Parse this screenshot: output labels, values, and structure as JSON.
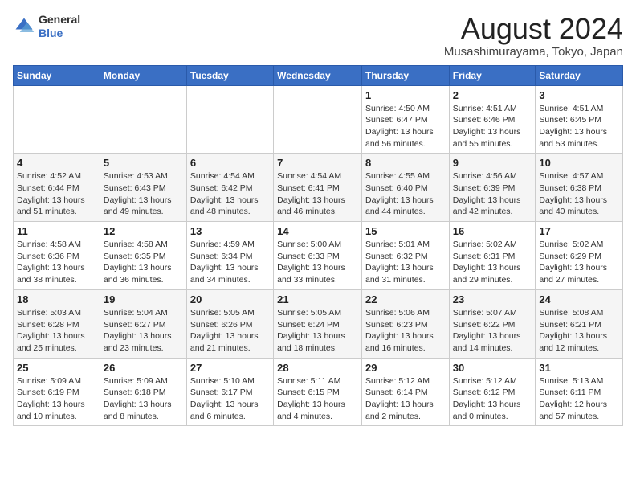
{
  "header": {
    "logo_general": "General",
    "logo_blue": "Blue",
    "main_title": "August 2024",
    "subtitle": "Musashimurayama, Tokyo, Japan"
  },
  "weekdays": [
    "Sunday",
    "Monday",
    "Tuesday",
    "Wednesday",
    "Thursday",
    "Friday",
    "Saturday"
  ],
  "weeks": [
    [
      {
        "day": "",
        "info": ""
      },
      {
        "day": "",
        "info": ""
      },
      {
        "day": "",
        "info": ""
      },
      {
        "day": "",
        "info": ""
      },
      {
        "day": "1",
        "info": "Sunrise: 4:50 AM\nSunset: 6:47 PM\nDaylight: 13 hours\nand 56 minutes."
      },
      {
        "day": "2",
        "info": "Sunrise: 4:51 AM\nSunset: 6:46 PM\nDaylight: 13 hours\nand 55 minutes."
      },
      {
        "day": "3",
        "info": "Sunrise: 4:51 AM\nSunset: 6:45 PM\nDaylight: 13 hours\nand 53 minutes."
      }
    ],
    [
      {
        "day": "4",
        "info": "Sunrise: 4:52 AM\nSunset: 6:44 PM\nDaylight: 13 hours\nand 51 minutes."
      },
      {
        "day": "5",
        "info": "Sunrise: 4:53 AM\nSunset: 6:43 PM\nDaylight: 13 hours\nand 49 minutes."
      },
      {
        "day": "6",
        "info": "Sunrise: 4:54 AM\nSunset: 6:42 PM\nDaylight: 13 hours\nand 48 minutes."
      },
      {
        "day": "7",
        "info": "Sunrise: 4:54 AM\nSunset: 6:41 PM\nDaylight: 13 hours\nand 46 minutes."
      },
      {
        "day": "8",
        "info": "Sunrise: 4:55 AM\nSunset: 6:40 PM\nDaylight: 13 hours\nand 44 minutes."
      },
      {
        "day": "9",
        "info": "Sunrise: 4:56 AM\nSunset: 6:39 PM\nDaylight: 13 hours\nand 42 minutes."
      },
      {
        "day": "10",
        "info": "Sunrise: 4:57 AM\nSunset: 6:38 PM\nDaylight: 13 hours\nand 40 minutes."
      }
    ],
    [
      {
        "day": "11",
        "info": "Sunrise: 4:58 AM\nSunset: 6:36 PM\nDaylight: 13 hours\nand 38 minutes."
      },
      {
        "day": "12",
        "info": "Sunrise: 4:58 AM\nSunset: 6:35 PM\nDaylight: 13 hours\nand 36 minutes."
      },
      {
        "day": "13",
        "info": "Sunrise: 4:59 AM\nSunset: 6:34 PM\nDaylight: 13 hours\nand 34 minutes."
      },
      {
        "day": "14",
        "info": "Sunrise: 5:00 AM\nSunset: 6:33 PM\nDaylight: 13 hours\nand 33 minutes."
      },
      {
        "day": "15",
        "info": "Sunrise: 5:01 AM\nSunset: 6:32 PM\nDaylight: 13 hours\nand 31 minutes."
      },
      {
        "day": "16",
        "info": "Sunrise: 5:02 AM\nSunset: 6:31 PM\nDaylight: 13 hours\nand 29 minutes."
      },
      {
        "day": "17",
        "info": "Sunrise: 5:02 AM\nSunset: 6:29 PM\nDaylight: 13 hours\nand 27 minutes."
      }
    ],
    [
      {
        "day": "18",
        "info": "Sunrise: 5:03 AM\nSunset: 6:28 PM\nDaylight: 13 hours\nand 25 minutes."
      },
      {
        "day": "19",
        "info": "Sunrise: 5:04 AM\nSunset: 6:27 PM\nDaylight: 13 hours\nand 23 minutes."
      },
      {
        "day": "20",
        "info": "Sunrise: 5:05 AM\nSunset: 6:26 PM\nDaylight: 13 hours\nand 21 minutes."
      },
      {
        "day": "21",
        "info": "Sunrise: 5:05 AM\nSunset: 6:24 PM\nDaylight: 13 hours\nand 18 minutes."
      },
      {
        "day": "22",
        "info": "Sunrise: 5:06 AM\nSunset: 6:23 PM\nDaylight: 13 hours\nand 16 minutes."
      },
      {
        "day": "23",
        "info": "Sunrise: 5:07 AM\nSunset: 6:22 PM\nDaylight: 13 hours\nand 14 minutes."
      },
      {
        "day": "24",
        "info": "Sunrise: 5:08 AM\nSunset: 6:21 PM\nDaylight: 13 hours\nand 12 minutes."
      }
    ],
    [
      {
        "day": "25",
        "info": "Sunrise: 5:09 AM\nSunset: 6:19 PM\nDaylight: 13 hours\nand 10 minutes."
      },
      {
        "day": "26",
        "info": "Sunrise: 5:09 AM\nSunset: 6:18 PM\nDaylight: 13 hours\nand 8 minutes."
      },
      {
        "day": "27",
        "info": "Sunrise: 5:10 AM\nSunset: 6:17 PM\nDaylight: 13 hours\nand 6 minutes."
      },
      {
        "day": "28",
        "info": "Sunrise: 5:11 AM\nSunset: 6:15 PM\nDaylight: 13 hours\nand 4 minutes."
      },
      {
        "day": "29",
        "info": "Sunrise: 5:12 AM\nSunset: 6:14 PM\nDaylight: 13 hours\nand 2 minutes."
      },
      {
        "day": "30",
        "info": "Sunrise: 5:12 AM\nSunset: 6:12 PM\nDaylight: 13 hours\nand 0 minutes."
      },
      {
        "day": "31",
        "info": "Sunrise: 5:13 AM\nSunset: 6:11 PM\nDaylight: 12 hours\nand 57 minutes."
      }
    ]
  ]
}
